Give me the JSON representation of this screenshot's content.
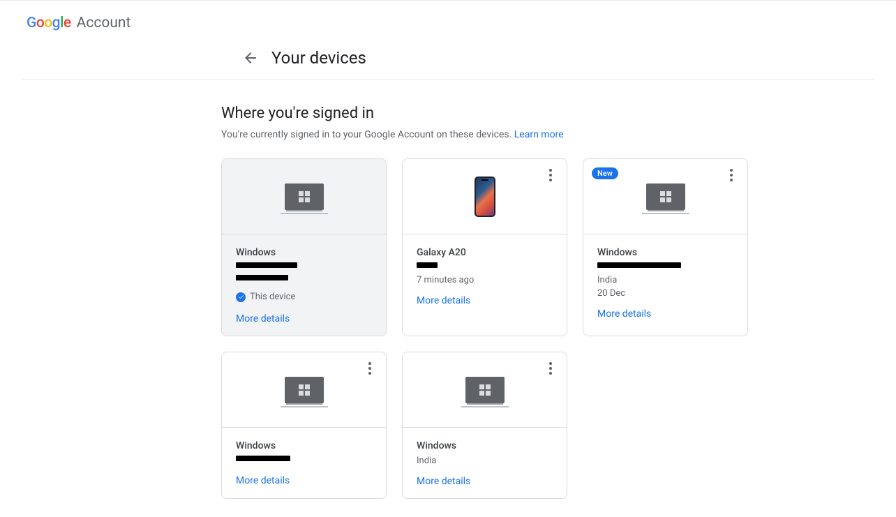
{
  "header": {
    "logo_google": "Google",
    "logo_account": "Account"
  },
  "page": {
    "title": "Your devices",
    "section_title": "Where you're signed in",
    "section_desc": "You're currently signed in to your Google Account on these devices. ",
    "learn_more": "Learn more"
  },
  "labels": {
    "more_details": "More details",
    "this_device": "This device",
    "new_badge": "New"
  },
  "devices": [
    {
      "name": "Windows",
      "type": "laptop",
      "current": true,
      "show_menu": false,
      "redacted_lines": [
        88,
        75
      ],
      "meta": [],
      "show_this_device": true
    },
    {
      "name": "Galaxy A20",
      "type": "phone",
      "current": false,
      "show_menu": true,
      "redacted_lines": [
        30
      ],
      "meta": [
        "7 minutes ago"
      ],
      "show_this_device": false
    },
    {
      "name": "Windows",
      "type": "laptop",
      "current": false,
      "show_menu": true,
      "new_badge": true,
      "redacted_lines": [
        120
      ],
      "meta": [
        "India",
        "20 Dec"
      ],
      "show_this_device": false
    },
    {
      "name": "Windows",
      "type": "laptop",
      "current": false,
      "show_menu": true,
      "redacted_lines": [
        78
      ],
      "meta": [],
      "show_this_device": false
    },
    {
      "name": "Windows",
      "type": "laptop",
      "current": false,
      "show_menu": true,
      "redacted_lines": [],
      "meta": [
        "India"
      ],
      "show_this_device": false
    }
  ]
}
